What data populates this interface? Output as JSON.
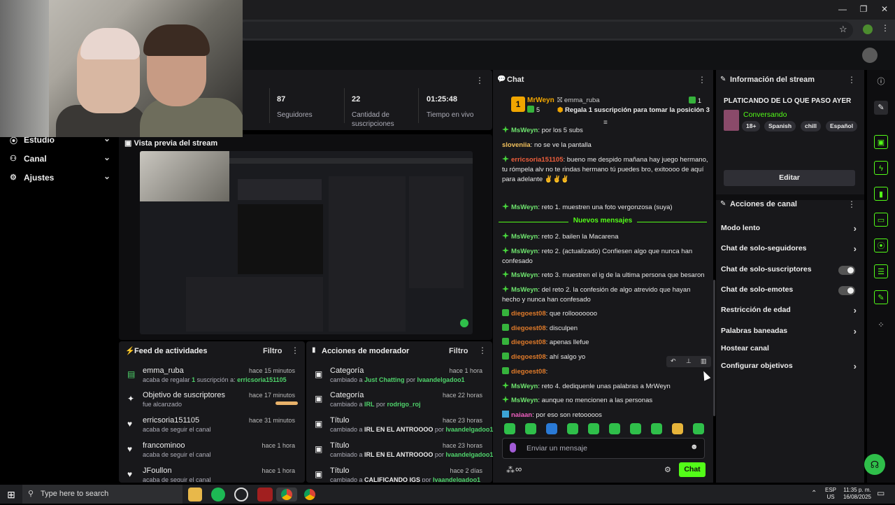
{
  "stats": [
    {
      "value": "87",
      "label": "Seguidores"
    },
    {
      "value": "22",
      "label": "Cantidad de suscripciones"
    },
    {
      "value": "01:25:48",
      "label": "Tiempo en vivo"
    }
  ],
  "stats_partial_label": "s",
  "sidebar": {
    "items": [
      {
        "label": "Estudio"
      },
      {
        "label": "Canal"
      },
      {
        "label": "Ajustes"
      }
    ]
  },
  "preview": {
    "title": "Vista previa del stream"
  },
  "activity": {
    "title": "Feed de actividades",
    "filter": "Filtro",
    "items": [
      {
        "name": "emma_ruba",
        "time": "hace 15 minutos",
        "sub_prefix": "acaba de regalar ",
        "sub_count": "1",
        "sub_mid": " suscripción a: ",
        "sub_target": "erricsoria151105"
      },
      {
        "name": "Objetivo de suscriptores",
        "time": "hace 17 minutos",
        "sub": "fue alcanzado"
      },
      {
        "name": "erricsoria151105",
        "time": "hace 31 minutos",
        "sub": "acaba de seguir el canal"
      },
      {
        "name": "francominoo",
        "time": "hace 1 hora",
        "sub": "acaba de seguir el canal"
      },
      {
        "name": "JFoullon",
        "time": "hace 1 hora",
        "sub": "acaba de seguir el canal"
      }
    ]
  },
  "moderator": {
    "title": "Acciones de moderador",
    "filter": "Filtro",
    "items": [
      {
        "name": "Categoría",
        "time": "hace 1 hora",
        "pre": "cambiado a ",
        "val": "Just Chatting",
        "by": " por ",
        "user": "Ivaandelgadoo1"
      },
      {
        "name": "Categoría",
        "time": "hace 22 horas",
        "pre": "cambiado a ",
        "val": "IRL",
        "by": " por ",
        "user": "rodrigo_roj"
      },
      {
        "name": "Título",
        "time": "hace 23 horas",
        "pre": "cambiado a ",
        "val": "IRL EN EL ANTROOOO",
        "by": " por ",
        "user": "Ivaandelgadoo1"
      },
      {
        "name": "Título",
        "time": "hace 23 horas",
        "pre": "cambiado a ",
        "val": "IRL EN EL ANTROOOO",
        "by": " por ",
        "user": "Ivaandelgadoo1"
      },
      {
        "name": "Título",
        "time": "hace 2 días",
        "pre": "cambiado a ",
        "val": "CALIFICANDO IGS",
        "by": " por ",
        "user": "Ivaandelgadoo1"
      }
    ]
  },
  "chat": {
    "title": "Chat",
    "pinned_user": "MrWeyn",
    "pinned_count": "5",
    "pinned_gifter": "emma_ruba",
    "pinned_rank": "1",
    "pinned_text": "Regala 1 suscripción para tomar la posición 3",
    "divider": "Nuevos mensajes",
    "messages": [
      {
        "user": "MsWeyn",
        "cls": "c-msw",
        "text": ": por los 5 subs"
      },
      {
        "user": "sloveniia",
        "cls": "c-slo",
        "text": ": no se ve la pantalla"
      },
      {
        "user": "erricsoria151105",
        "cls": "c-err",
        "text": ": bueno me despido mañana hay juego hermano, tu rómpela alv no te rindas hermano tú puedes bro, exitoooo de aquí para adelante ✌️✌️✌️"
      },
      {
        "user": "MsWeyn",
        "cls": "c-msw",
        "text": ": reto 1. muestren una foto vergonzosa (suya)"
      },
      {
        "user": "MsWeyn",
        "cls": "c-msw",
        "text": ": reto 2. bailen la Macarena"
      },
      {
        "user": "MsWeyn",
        "cls": "c-msw",
        "text": ": reto 2. (actualizado) Confiesen algo que nunca han confesado"
      },
      {
        "user": "MsWeyn",
        "cls": "c-msw",
        "text": ": reto 3. muestren el ig de la ultima persona que besaron"
      },
      {
        "user": "MsWeyn",
        "cls": "c-msw",
        "text": ": del reto 2. la confesión de algo atrevido que hayan hecho y nunca han confesado"
      },
      {
        "user": "diegoest08",
        "cls": "c-die",
        "text": ": que rollooooooo"
      },
      {
        "user": "diegoest08",
        "cls": "c-die",
        "text": ": disculpen"
      },
      {
        "user": "diegoest08",
        "cls": "c-die",
        "text": ": apenas llefue"
      },
      {
        "user": "diegoest08",
        "cls": "c-die",
        "text": ": ahí salgo yo"
      },
      {
        "user": "diegoest08",
        "cls": "c-die",
        "text": ":"
      },
      {
        "user": "MsWeyn",
        "cls": "c-msw",
        "text": ": reto 4. dediquenle unas palabras a MrWeyn"
      },
      {
        "user": "MsWeyn",
        "cls": "c-msw",
        "text": ": aunque no mencionen a las personas"
      },
      {
        "user": "naiaan",
        "cls": "c-nai",
        "text": ": por eso son retooooos"
      }
    ],
    "input_placeholder": "Enviar un mensaje",
    "send_label": "Chat",
    "infinity": "∞"
  },
  "stream_info": {
    "title": "Información del stream",
    "stream_title": "PLATICANDO DE LO QUE PASO AYER",
    "category": "Conversando",
    "tags": [
      "18+",
      "Spanish",
      "chill",
      "Español"
    ],
    "edit_label": "Editar"
  },
  "channel_actions": {
    "title": "Acciones de canal",
    "items": [
      {
        "label": "Modo lento",
        "type": "chev"
      },
      {
        "label": "Chat de solo-seguidores",
        "type": "chev"
      },
      {
        "label": "Chat de solo-suscriptores",
        "type": "toggle"
      },
      {
        "label": "Chat de solo-emotes",
        "type": "toggle"
      },
      {
        "label": "Restricción de edad",
        "type": "chev"
      },
      {
        "label": "Palabras baneadas",
        "type": "chev"
      },
      {
        "label": "Hostear canal",
        "type": "none"
      },
      {
        "label": "Configurar objetivos",
        "type": "chev"
      }
    ]
  },
  "taskbar": {
    "search_placeholder": "Type here to search",
    "lang1": "ESP",
    "lang2": "US",
    "time": "11:35 p. m.",
    "date": "16/08/2025"
  },
  "colors": {
    "accent": "#53fc18",
    "panel": "#18181b",
    "bg": "#000000"
  }
}
